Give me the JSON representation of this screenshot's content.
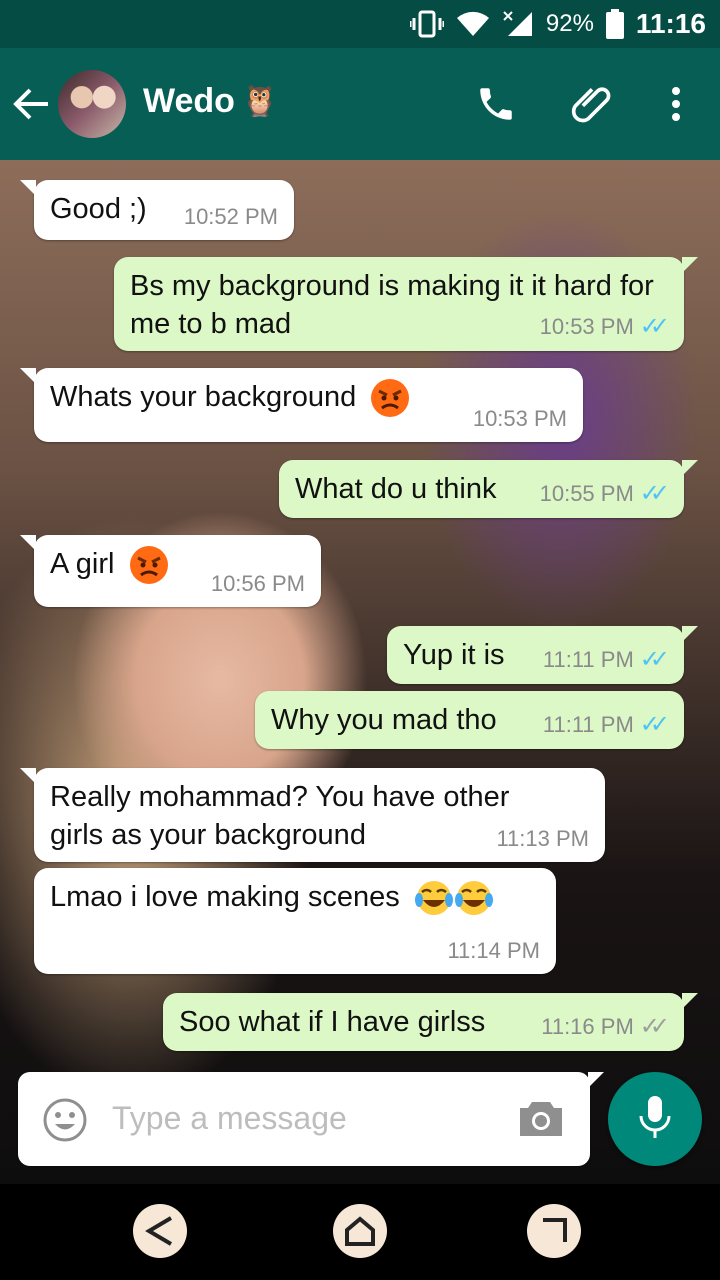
{
  "status_bar": {
    "battery": "92%",
    "time": "11:16"
  },
  "header": {
    "contact_name": "Wedo",
    "contact_emoji": "🦉"
  },
  "messages": [
    {
      "text": "Good ;)",
      "time": "10:52 PM"
    },
    {
      "text": "Bs my background is making it it hard for me to b mad",
      "time": "10:53 PM",
      "status": "read"
    },
    {
      "text": "Whats your background",
      "time": "10:53 PM"
    },
    {
      "text": "What do u think",
      "time": "10:55 PM",
      "status": "read"
    },
    {
      "text": "A girl",
      "time": "10:56 PM"
    },
    {
      "text": "Yup it is",
      "time": "11:11 PM",
      "status": "read"
    },
    {
      "text": "Why you mad tho",
      "time": "11:11 PM",
      "status": "read"
    },
    {
      "text": "Really mohammad? You have other girls as your background",
      "time": "11:13 PM"
    },
    {
      "text": "Lmao i love making scenes",
      "time": "11:14 PM"
    },
    {
      "text": "Soo what if I have girlss",
      "time": "11:16 PM",
      "status": "delivered"
    }
  ],
  "composer": {
    "placeholder": "Type a message"
  },
  "colors": {
    "header": "#075e54",
    "status_bar": "#054d44",
    "outgoing": "#dcf8c6",
    "incoming": "#ffffff",
    "fab": "#00897b",
    "read_tick": "#4fc3f7"
  },
  "icons": [
    "vibrate-icon",
    "wifi-icon",
    "signal-icon",
    "battery-icon",
    "back-arrow-icon",
    "phone-icon",
    "attach-icon",
    "more-icon",
    "angry-emoji",
    "tears-of-joy-emoji",
    "emoji-icon",
    "camera-icon",
    "mic-icon",
    "nav-back-icon",
    "nav-home-icon",
    "nav-recents-icon"
  ]
}
